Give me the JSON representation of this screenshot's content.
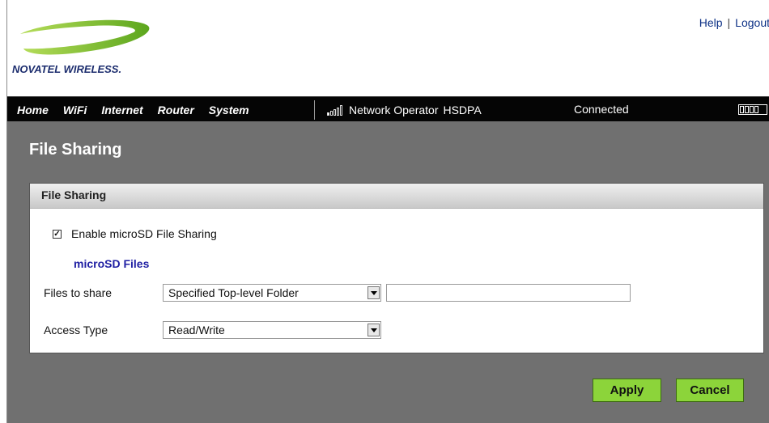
{
  "brand": {
    "logo_text": "NOVATEL WIRELESS."
  },
  "top_links": {
    "help": "Help",
    "separator": "|",
    "logout": "Logout"
  },
  "nav": {
    "items": [
      "Home",
      "WiFi",
      "Internet",
      "Router",
      "System"
    ]
  },
  "status": {
    "network": "Network Operator",
    "tech": "HSDPA",
    "connection": "Connected",
    "signal_bars_lit": 1,
    "signal_bars_total": 5
  },
  "page": {
    "title": "File Sharing"
  },
  "panel": {
    "title": "File Sharing",
    "enable_label": "Enable microSD File Sharing",
    "enable_checked": true,
    "section_label": "microSD Files",
    "files_to_share_label": "Files to share",
    "files_to_share_value": "Specified Top-level Folder",
    "folder_value": "",
    "access_type_label": "Access Type",
    "access_type_value": "Read/Write"
  },
  "buttons": {
    "apply": "Apply",
    "cancel": "Cancel"
  },
  "colors": {
    "button": "#8cd43a",
    "nav_bg": "#050505",
    "content_bg": "#707070",
    "logo_swoosh": "#8dc63f",
    "link": "#1f1fa3"
  }
}
